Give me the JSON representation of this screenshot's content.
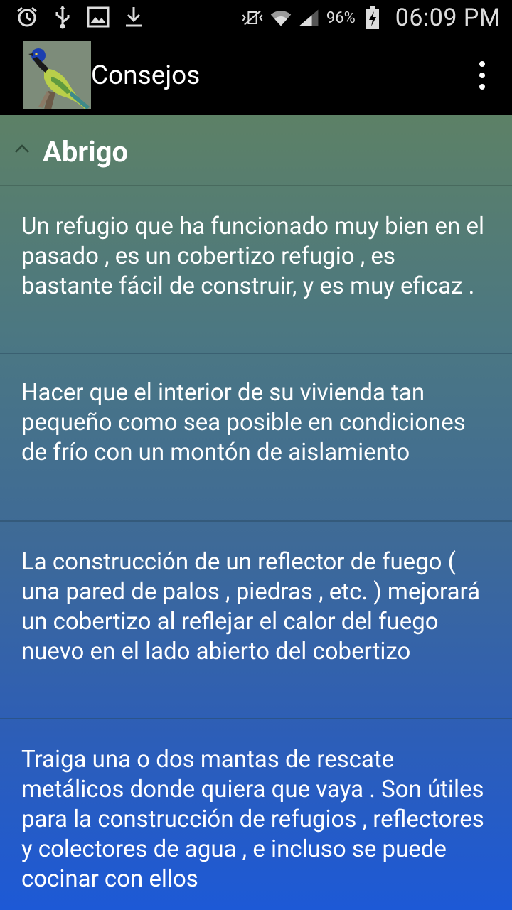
{
  "status_bar": {
    "left_icons": [
      "alarm-icon",
      "usb-icon",
      "image-icon",
      "download-icon"
    ],
    "right_icons": [
      "vibrate-mute-icon",
      "wifi-icon",
      "signal-icon",
      "battery-charging-icon"
    ],
    "battery_percent": "96%",
    "time": "06:09 PM"
  },
  "action_bar": {
    "title": "Consejos",
    "logo": "bird-logo",
    "overflow_icon": "overflow-menu-icon"
  },
  "section": {
    "title": "Abrigo",
    "expanded_icon": "chevron-up-icon",
    "items": [
      {
        "text": "Un refugio que ha funcionado muy bien en el pasado , es un cobertizo refugio , es bastante fácil de construir, y es muy eficaz ."
      },
      {
        "text": "Hacer que el interior de su vivienda tan pequeño como sea posible en condiciones de frío con un montón de aislamiento"
      },
      {
        "text": "La construcción de un reflector de fuego ( una pared de palos , piedras , etc. ) mejorará un cobertizo al reflejar el calor del fuego nuevo en el lado abierto del cobertizo"
      },
      {
        "text": "Traiga una o dos mantas de rescate metálicos donde quiera que vaya . Son útiles para la construcción de refugios , reflectores y colectores de agua , e incluso se puede cocinar con ellos"
      }
    ]
  }
}
